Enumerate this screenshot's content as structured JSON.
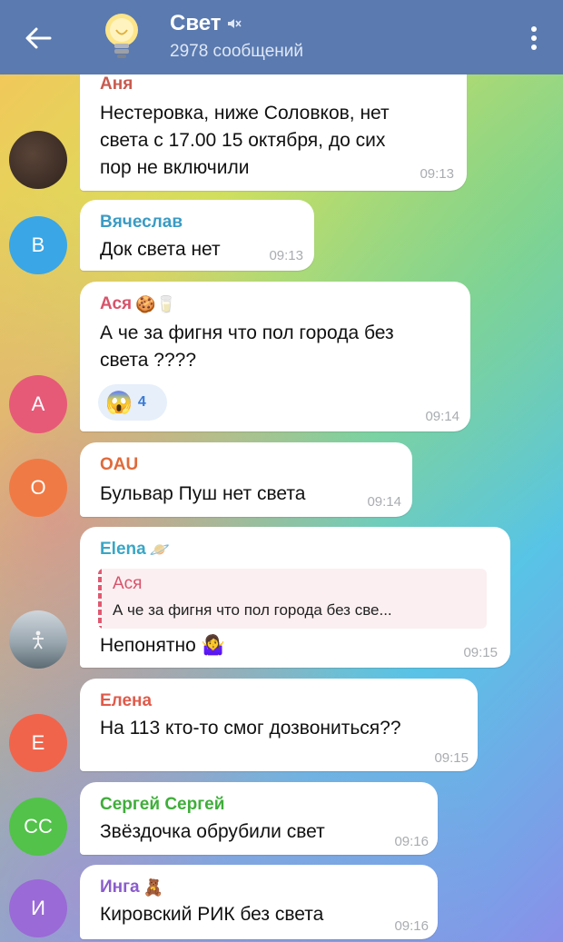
{
  "header": {
    "title": "Свет",
    "subtitle": "2978 сообщений",
    "avatar_icon": "lightbulb-icon",
    "muted_icon": "muted-speaker-icon"
  },
  "messages": [
    {
      "author": "Аня",
      "author_color": "#c85a4e",
      "lines": [
        "Нестеровка, ниже Соловков, нет",
        "света с 17.00 15 октября, до сих",
        "пор не включили"
      ],
      "time": "09:13",
      "avatar": "photo"
    },
    {
      "author": "Вячеслав",
      "author_color": "#3a9bc4",
      "lines": [
        "Док света нет"
      ],
      "time": "09:13",
      "avatar_letter": "В",
      "avatar_color": "#3aa6e6"
    },
    {
      "author": "Ася",
      "author_color": "#d8536b",
      "author_emoji": "🍪🥛",
      "lines": [
        "А че за фигня что пол города без",
        "света ????"
      ],
      "time": "09:14",
      "avatar_letter": "А",
      "avatar_color": "#e65a78",
      "reaction": {
        "emoji": "😱",
        "count": "4"
      }
    },
    {
      "author": "OAU",
      "author_color": "#e06a3a",
      "lines": [
        "Бульвар Пуш нет света"
      ],
      "time": "09:14",
      "avatar_letter": "O",
      "avatar_color": "#f07a45"
    },
    {
      "author": "Elena",
      "author_color": "#39a6c6",
      "author_emoji": "🪐",
      "quote_author": "Ася",
      "quote_text": "А че за фигня что пол города без све...",
      "lines": [
        "Непонятно 🤷‍♀️"
      ],
      "time": "09:15",
      "avatar": "photo"
    },
    {
      "author": "Елена",
      "author_color": "#e05a4a",
      "lines": [
        "На 113 кто-то смог дозвониться??"
      ],
      "time": "09:15",
      "avatar_letter": "Е",
      "avatar_color": "#f0644c"
    },
    {
      "author": "Сергей Сергей",
      "author_color": "#3fae3a",
      "lines": [
        "Звёздочка обрубили свет"
      ],
      "time": "09:16",
      "avatar_letter": "СС",
      "avatar_color": "#52c24a"
    },
    {
      "author": "Инга",
      "author_color": "#8a5ccc",
      "author_emoji": "🧸",
      "lines": [
        "Кировский РИК без света"
      ],
      "time": "09:16",
      "avatar_letter": "И",
      "avatar_color": "#9a6ad6"
    }
  ]
}
